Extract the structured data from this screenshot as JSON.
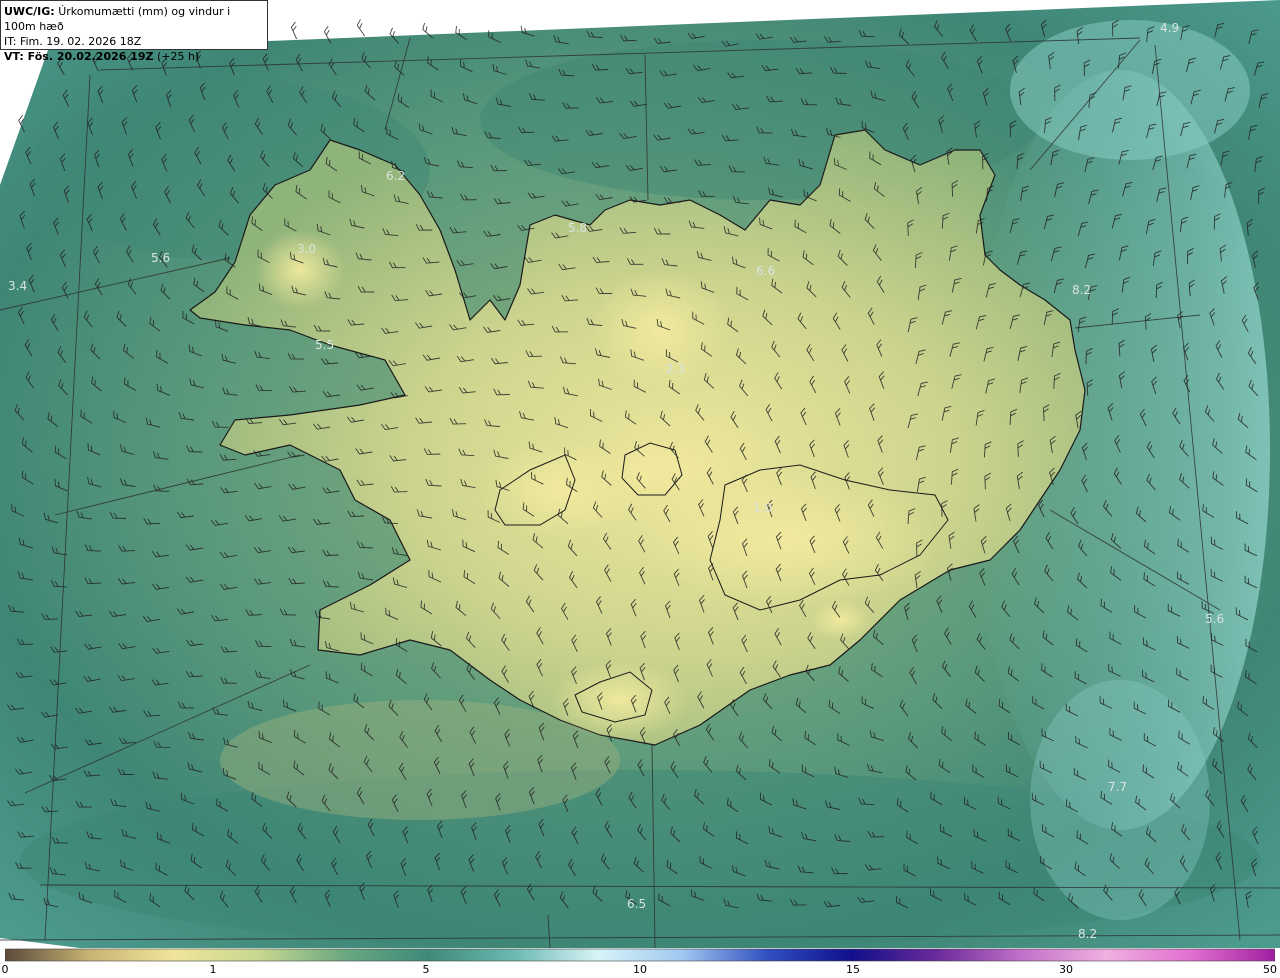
{
  "header": {
    "model": "UWC/IG:",
    "title": "Úrkomumætti (mm) og vindur i 100m hæð",
    "it_line": "IT: Fim. 19. 02. 2026 18Z",
    "vt_prefix": "VT: Fös. 20.02.2026 19Z",
    "vt_suffix": "(+25 h)"
  },
  "map_labels": [
    {
      "id": "v1",
      "text": "3.4"
    },
    {
      "id": "v2",
      "text": "5.6"
    },
    {
      "id": "v3",
      "text": "3.0"
    },
    {
      "id": "v4",
      "text": "6.2"
    },
    {
      "id": "v5",
      "text": "5.5"
    },
    {
      "id": "v6",
      "text": "5.8"
    },
    {
      "id": "v7",
      "text": "6.6"
    },
    {
      "id": "v8",
      "text": "2.3"
    },
    {
      "id": "v9",
      "text": "1.0"
    },
    {
      "id": "v10",
      "text": "4.9"
    },
    {
      "id": "v11",
      "text": "8.2"
    },
    {
      "id": "v12",
      "text": "5.6"
    },
    {
      "id": "v13",
      "text": "7.7"
    },
    {
      "id": "v14",
      "text": "6.5"
    },
    {
      "id": "v15",
      "text": "8.2"
    }
  ],
  "colorbar": {
    "ticks": [
      "0",
      "1",
      "5",
      "10",
      "15",
      "30",
      "50"
    ],
    "colors": [
      "#5a4a3a",
      "#c8b474",
      "#f0e59a",
      "#c8d890",
      "#6aa880",
      "#3e8a7a",
      "#6ab8b0",
      "#d8f4f8",
      "#a0c8f0",
      "#3050c0",
      "#10108a",
      "#6a2a9a",
      "#c070c8",
      "#f0b0e0",
      "#e070d0",
      "#a020a0"
    ]
  },
  "colors": {
    "sea_dark": "#2f7a6e",
    "sea_mid": "#4f9682",
    "land_yellow": "#e6df94",
    "land_green": "#9fbf7e",
    "coast": "#1a1a1a"
  }
}
